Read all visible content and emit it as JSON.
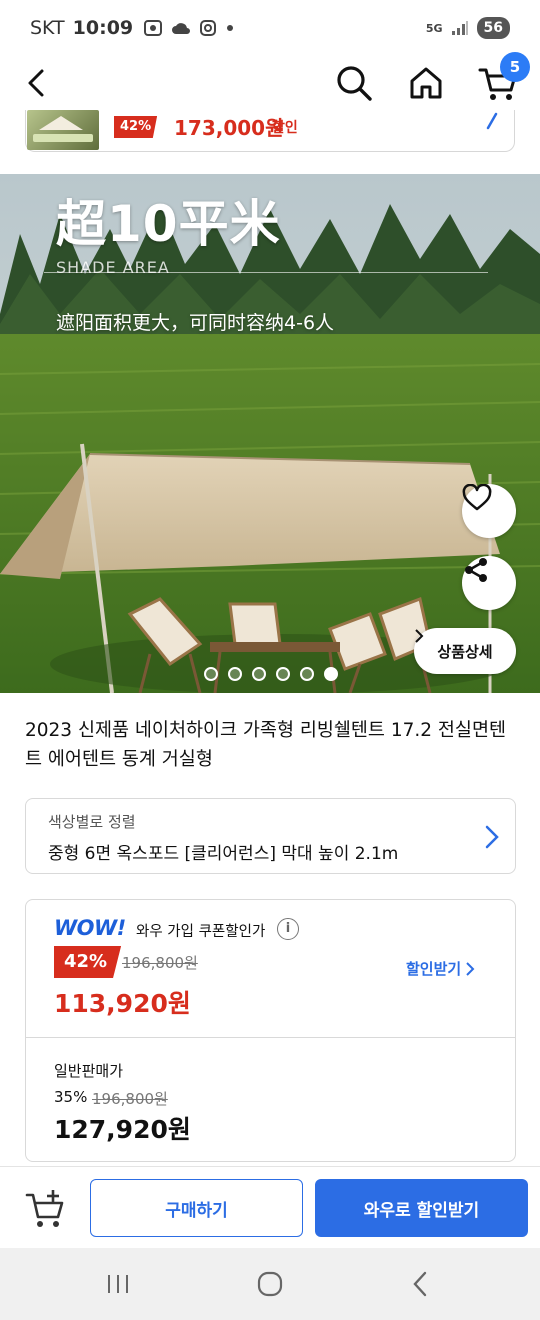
{
  "status_bar": {
    "carrier": "SKT",
    "time": "10:09",
    "network": "5G",
    "battery": "56"
  },
  "header": {
    "cart_count": "5"
  },
  "sticky_bar": {
    "discount_pct": "42%",
    "price": "173,000원",
    "discount_label": "할인"
  },
  "hero": {
    "headline": "超10平米",
    "subtitle_en": "SHADE AREA",
    "caption": "遮阳面积更大，可同时容纳4-6人",
    "detail_button": "상품상세",
    "slide_count": 6,
    "active_slide": 6
  },
  "product": {
    "title": "2023 신제품 네이처하이크 가족형 리빙쉘텐트 17.2 전실면텐트 에어텐트 동계 거실형"
  },
  "option": {
    "label": "색상별로 정렬",
    "value": "중형 6면 옥스포드 [클리어런스] 막대 높이 2.1m"
  },
  "pricing": {
    "wow_logo": "WOW!",
    "wow_text": "와우 가입 쿠폰할인가",
    "wow_discount_pct": "42%",
    "original_price": "196,800원",
    "wow_price": "113,920원",
    "get_discount": "할인받기",
    "general_label": "일반판매가",
    "general_discount_pct": "35%",
    "general_original_price": "196,800원",
    "general_price": "127,920원"
  },
  "actions": {
    "buy_label": "구매하기",
    "wow_button_label": "와우로 할인받기"
  },
  "colors": {
    "accent_blue": "#2c6de4",
    "discount_red": "#d72d1d",
    "badge_blue": "#2c7cf6"
  }
}
